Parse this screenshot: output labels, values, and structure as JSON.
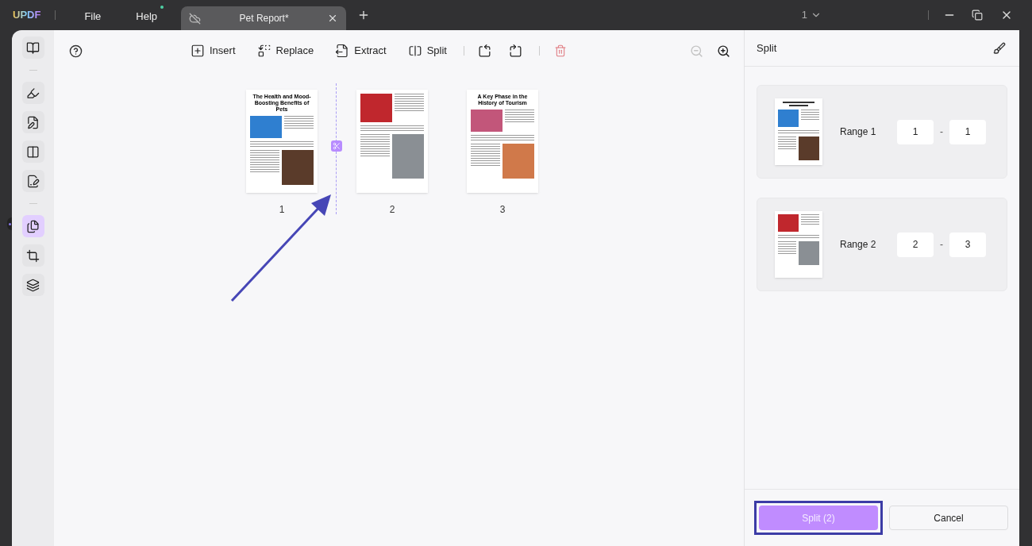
{
  "app": {
    "logo": "UPDF",
    "menu": [
      {
        "label": "File",
        "badge": false
      },
      {
        "label": "Help",
        "badge": true
      }
    ]
  },
  "tabs": [
    {
      "title": "Pet Report*",
      "selected": true
    }
  ],
  "page_indicator": "1",
  "sidebar": {
    "groups": [
      [
        {
          "kind": "reader",
          "selected": false
        }
      ],
      [
        {
          "kind": "highlighter",
          "selected": false
        },
        {
          "kind": "edit",
          "selected": false
        },
        {
          "kind": "columns",
          "selected": false
        },
        {
          "kind": "form",
          "selected": false
        }
      ],
      [
        {
          "kind": "organize",
          "selected": true
        },
        {
          "kind": "crop",
          "selected": false
        },
        {
          "kind": "layers",
          "selected": false
        }
      ]
    ]
  },
  "toolbar": {
    "actions": [
      {
        "kind": "insert",
        "label": "Insert"
      },
      {
        "kind": "replace",
        "label": "Replace"
      },
      {
        "kind": "extract",
        "label": "Extract"
      },
      {
        "kind": "split",
        "label": "Split"
      }
    ],
    "page_tools": [
      {
        "kind": "rotate-left",
        "disabled": false
      },
      {
        "kind": "rotate-right",
        "disabled": false
      }
    ],
    "delete": {
      "disabled": false
    },
    "zoom": [
      {
        "kind": "zoom-out",
        "disabled": true
      },
      {
        "kind": "zoom-in",
        "disabled": false
      }
    ]
  },
  "pages": [
    {
      "number": "1",
      "kind": "pets",
      "title": "The Health and Mood-Boosting Benefits of Pets",
      "split_after": true
    },
    {
      "number": "2",
      "kind": "animals",
      "split_after": false
    },
    {
      "number": "3",
      "kind": "tourism",
      "title": "A Key Phase in the History of Tourism"
    }
  ],
  "panel": {
    "title": "Split",
    "ranges": [
      {
        "label": "Range 1",
        "from": "1",
        "to": "1",
        "separator": "-"
      },
      {
        "label": "Range 2",
        "from": "2",
        "to": "3",
        "separator": "-"
      }
    ],
    "buttons": [
      {
        "label": "Split (2)",
        "kind": "primary",
        "highlighted": true
      },
      {
        "label": "Cancel",
        "kind": "secondary",
        "highlighted": false
      }
    ]
  }
}
